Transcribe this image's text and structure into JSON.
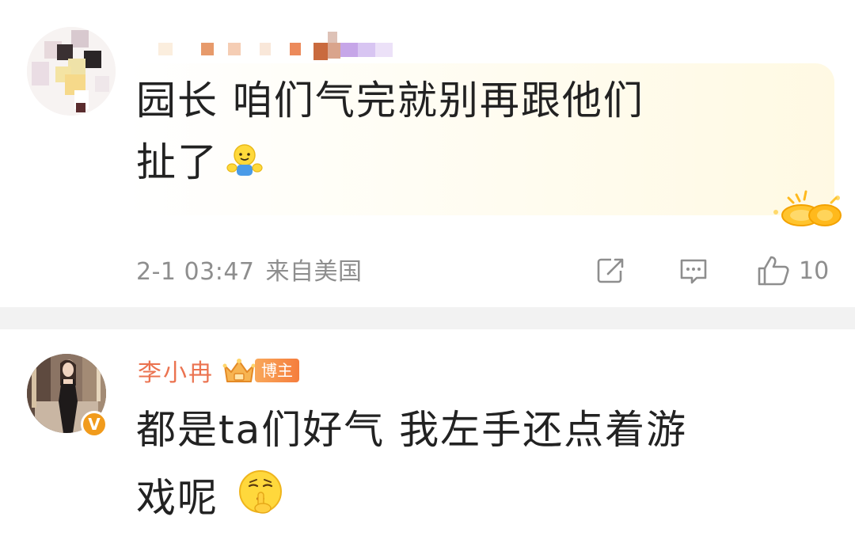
{
  "comments": [
    {
      "text_line1": "园长 咱们气完就别再跟他们",
      "text_line2": "扯了",
      "emoji": "hug-emoji",
      "time": "2-1 03:47",
      "location": "来自美国",
      "likes": "10"
    },
    {
      "username": "李小冉",
      "badge_label": "博主",
      "text_line1": "都是ta们好气 我左手还点着游",
      "text_line2": "戏呢",
      "emoji": "shush-emoji",
      "verified_mark": "V"
    }
  ],
  "icons": {
    "repost": "repost-icon",
    "comment": "comment-icon",
    "like": "thumbs-up-icon"
  },
  "colors": {
    "username_orange": "#eb7350",
    "meta_gray": "#8e8e8e",
    "text": "#222222",
    "divider": "#f2f2f2"
  }
}
